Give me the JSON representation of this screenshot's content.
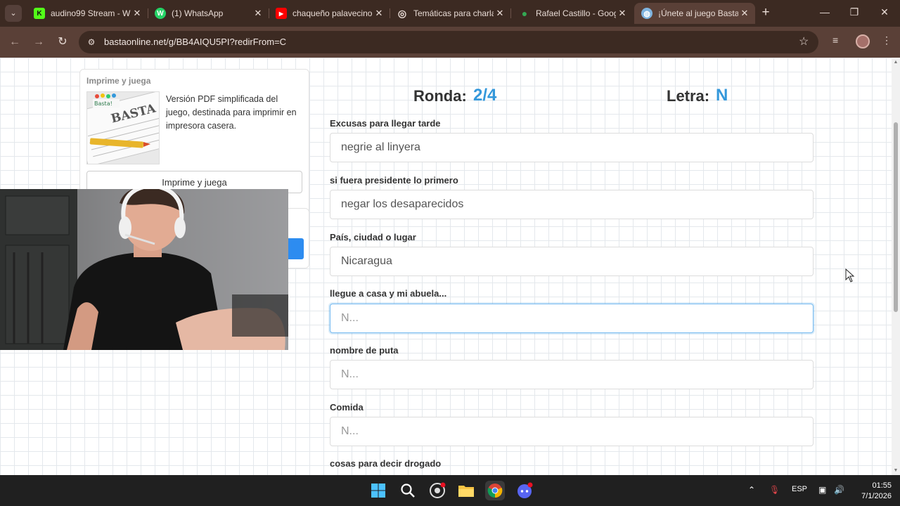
{
  "browser": {
    "tabs": [
      {
        "title": "audino99 Stream - W",
        "fav": "K"
      },
      {
        "title": "(1) WhatsApp",
        "fav": "W"
      },
      {
        "title": "chaqueño palavecino",
        "fav": "▶"
      },
      {
        "title": "Temáticas para charla",
        "fav": "◎"
      },
      {
        "title": "Rafael Castillo - Goog",
        "fav": "●"
      },
      {
        "title": "¡Únete al juego Basta",
        "fav": "◍"
      }
    ],
    "url": "bastaonline.net/g/BB4AIQU5PI?redirFrom=C"
  },
  "sidebar": {
    "title": "Imprime y juega",
    "description": "Versión PDF simplificada del juego, destinada para imprimir en impresora casera.",
    "button_label": "Imprime y juega"
  },
  "game": {
    "ronda_label": "Ronda:",
    "ronda_value": "2/4",
    "letra_label": "Letra:",
    "letra_value": "N",
    "fields": [
      {
        "label": "Excusas para llegar tarde",
        "value": "negrie al linyera",
        "placeholder": "N..."
      },
      {
        "label": "si fuera presidente lo primero",
        "value": "negar los desaparecidos",
        "placeholder": "N..."
      },
      {
        "label": "País, ciudad o lugar",
        "value": "Nicaragua",
        "placeholder": "N..."
      },
      {
        "label": "llegue a casa y mi abuela...",
        "value": "",
        "placeholder": "N..."
      },
      {
        "label": "nombre de puta",
        "value": "",
        "placeholder": "N..."
      },
      {
        "label": "Comida",
        "value": "",
        "placeholder": "N..."
      },
      {
        "label": "cosas para decir drogado",
        "value": "",
        "placeholder": "N..."
      }
    ]
  },
  "taskbar": {
    "language": "ESP",
    "time": "01:55",
    "date": "7/1/2026"
  },
  "colors": {
    "accent": "#3498db",
    "chrome_dark": "#3c2a22",
    "chrome": "#5a4037",
    "taskbar": "#202020"
  }
}
